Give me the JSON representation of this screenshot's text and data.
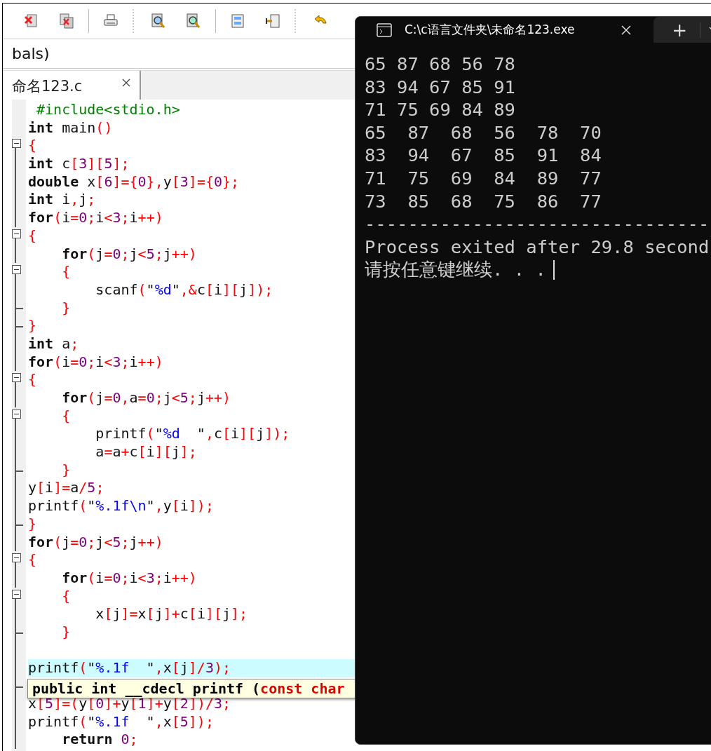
{
  "toolbar": {
    "scope": "bals)"
  },
  "tabs": [
    {
      "label": "命名123.c",
      "selected": true
    }
  ],
  "code": [
    {
      "kind": "line",
      "text": " #include<stdio.h>",
      "in_block": false,
      "collapsible": false,
      "block_end": false,
      "current": false
    },
    {
      "kind": "line",
      "text": "**int** main()",
      "in_block": false,
      "collapsible": false,
      "block_end": false,
      "current": false
    },
    {
      "kind": "line",
      "text": "{",
      "in_block": true,
      "collapsible": true,
      "block_end": false,
      "current": false
    },
    {
      "kind": "line",
      "text": "**int** c[3][5];",
      "in_block": true,
      "collapsible": false,
      "block_end": false,
      "current": false
    },
    {
      "kind": "line",
      "text": "**double** x[6]={0},y[3]={0};",
      "in_block": true,
      "collapsible": false,
      "block_end": false,
      "current": false
    },
    {
      "kind": "line",
      "text": "**int** i,j;",
      "in_block": true,
      "collapsible": false,
      "block_end": false,
      "current": false
    },
    {
      "kind": "line",
      "text": "**for**(i=0;i<3;i++)",
      "in_block": true,
      "collapsible": false,
      "block_end": false,
      "current": false
    },
    {
      "kind": "line",
      "text": "{",
      "in_block": true,
      "collapsible": true,
      "block_end": false,
      "current": false
    },
    {
      "kind": "line",
      "text": "    **for**(j=0;j<5;j++)",
      "in_block": true,
      "collapsible": false,
      "block_end": false,
      "current": false
    },
    {
      "kind": "line",
      "text": "    {",
      "in_block": true,
      "collapsible": true,
      "block_end": false,
      "current": false
    },
    {
      "kind": "line",
      "text": "        scanf(\"%d\",&c[i][j]);",
      "in_block": true,
      "collapsible": false,
      "block_end": false,
      "current": false
    },
    {
      "kind": "line",
      "text": "    }",
      "in_block": true,
      "collapsible": false,
      "block_end": true,
      "current": false
    },
    {
      "kind": "line",
      "text": "}",
      "in_block": true,
      "collapsible": false,
      "block_end": true,
      "current": false
    },
    {
      "kind": "line",
      "text": "**int** a;",
      "in_block": true,
      "collapsible": false,
      "block_end": false,
      "current": false
    },
    {
      "kind": "line",
      "text": "**for**(i=0;i<3;i++)",
      "in_block": true,
      "collapsible": false,
      "block_end": false,
      "current": false
    },
    {
      "kind": "line",
      "text": "{",
      "in_block": true,
      "collapsible": true,
      "block_end": false,
      "current": false
    },
    {
      "kind": "line",
      "text": "    **for**(j=0,a=0;j<5;j++)",
      "in_block": true,
      "collapsible": false,
      "block_end": false,
      "current": false
    },
    {
      "kind": "line",
      "text": "    {",
      "in_block": true,
      "collapsible": true,
      "block_end": false,
      "current": false
    },
    {
      "kind": "line",
      "text": "        printf(\"%d  \",c[i][j]);",
      "in_block": true,
      "collapsible": false,
      "block_end": false,
      "current": false
    },
    {
      "kind": "line",
      "text": "        a=a+c[i][j];",
      "in_block": true,
      "collapsible": false,
      "block_end": false,
      "current": false
    },
    {
      "kind": "line",
      "text": "    }",
      "in_block": true,
      "collapsible": false,
      "block_end": true,
      "current": false
    },
    {
      "kind": "line",
      "text": "y[i]=a/5;",
      "in_block": true,
      "collapsible": false,
      "block_end": false,
      "current": false
    },
    {
      "kind": "line",
      "text": "printf(\"%.1f\\n\",y[i]);",
      "in_block": true,
      "collapsible": false,
      "block_end": false,
      "current": false
    },
    {
      "kind": "line",
      "text": "}",
      "in_block": true,
      "collapsible": false,
      "block_end": true,
      "current": false
    },
    {
      "kind": "line",
      "text": "**for**(j=0;j<5;j++)",
      "in_block": true,
      "collapsible": false,
      "block_end": false,
      "current": false
    },
    {
      "kind": "line",
      "text": "{",
      "in_block": true,
      "collapsible": true,
      "block_end": false,
      "current": false
    },
    {
      "kind": "line",
      "text": "    **for**(i=0;i<3;i++)",
      "in_block": true,
      "collapsible": false,
      "block_end": false,
      "current": false
    },
    {
      "kind": "line",
      "text": "    {",
      "in_block": true,
      "collapsible": true,
      "block_end": false,
      "current": false
    },
    {
      "kind": "line",
      "text": "        x[j]=x[j]+c[i][j];",
      "in_block": true,
      "collapsible": false,
      "block_end": false,
      "current": false
    },
    {
      "kind": "line",
      "text": "    }",
      "in_block": true,
      "collapsible": false,
      "block_end": true,
      "current": false
    },
    {
      "kind": "line",
      "in_block": true,
      "collapsible": false,
      "block_end": false,
      "current": false
    },
    {
      "kind": "line",
      "text": "printf(\"%.1f  \",x[j]/3);",
      "in_block": true,
      "collapsible": false,
      "block_end": false,
      "current": true
    },
    {
      "kind": "tooltip",
      "text": "public int __cdecl printf (",
      "param": "const char",
      "in_block": true,
      "collapsible": false,
      "block_end": true
    },
    {
      "kind": "line",
      "text": "x[5]=(y[0]+y[1]+y[2])/3;",
      "in_block": true,
      "collapsible": false,
      "block_end": false,
      "current": false
    },
    {
      "kind": "line",
      "text": "printf(\"%.1f  \",x[5]);",
      "in_block": true,
      "collapsible": false,
      "block_end": false,
      "current": false
    },
    {
      "kind": "line",
      "text": "    **return** 0;",
      "in_block": true,
      "collapsible": false,
      "block_end": false,
      "current": false
    }
  ],
  "console": {
    "title": "C:\\c语言文件夹\\未命名123.exe",
    "new_tab": "+",
    "lines": [
      "65 87 68 56 78",
      "83 94 67 85 91",
      "71 75 69 84 89",
      "65  87  68  56  78  70",
      "83  94  67  85  91  84",
      "71  75  69  84  89  77",
      "73  85  68  75  86  77",
      "--------------------------------",
      "Process exited after 29.8 second"
    ],
    "prompt": "请按任意键继续. . ."
  }
}
